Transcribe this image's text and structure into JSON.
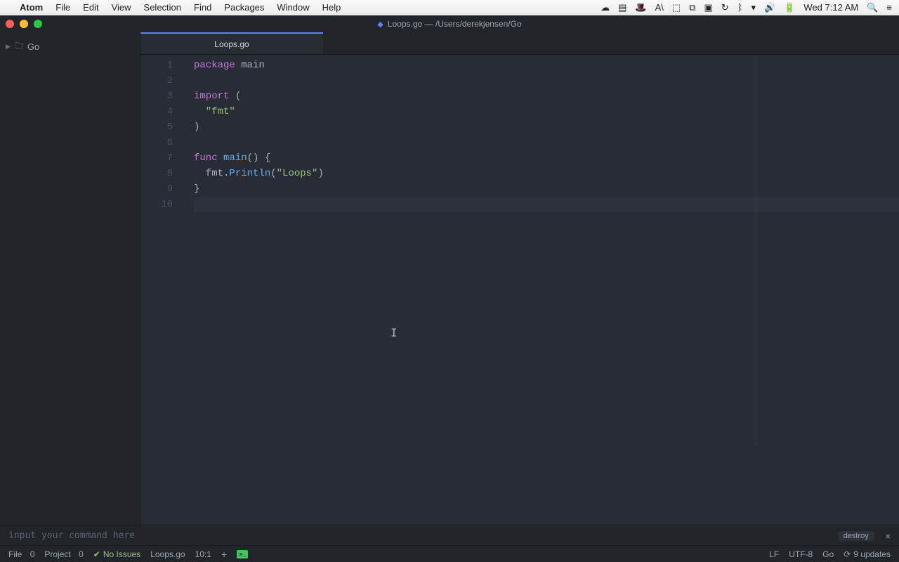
{
  "menubar": {
    "app_name": "Atom",
    "items": [
      "File",
      "Edit",
      "View",
      "Selection",
      "Find",
      "Packages",
      "Window",
      "Help"
    ],
    "clock": "Wed 7:12 AM"
  },
  "window": {
    "title_file": "Loops.go",
    "title_sep": " — ",
    "title_path": "/Users/derekjensen/Go"
  },
  "sidebar": {
    "root_folder": "Go"
  },
  "tab": {
    "label": "Loops.go"
  },
  "code": {
    "line1_kw": "package",
    "line1_ident": " main",
    "line3_kw": "import",
    "line3_rest": " (",
    "line4_str": "  \"fmt\"",
    "line5": ")",
    "line7_kw": "func",
    "line7_name": " main",
    "line7_rest1": "() {",
    "line8_pre": "  fmt.",
    "line8_fn": "Println",
    "line8_open": "(",
    "line8_str": "\"Loops\"",
    "line8_close": ")",
    "line9": "}"
  },
  "gutter": {
    "n1": "1",
    "n2": "2",
    "n3": "3",
    "n4": "4",
    "n5": "5",
    "n6": "6",
    "n7": "7",
    "n8": "8",
    "n9": "9",
    "n10": "10"
  },
  "command": {
    "placeholder": "input your command here",
    "destroy": "destroy"
  },
  "status": {
    "file_label": "File",
    "file_count": "0",
    "project_label": "Project",
    "project_count": "0",
    "issues": "No Issues",
    "filename": "Loops.go",
    "cursor": "10:1",
    "line_ending": "LF",
    "encoding": "UTF-8",
    "grammar": "Go",
    "updates": "9 updates"
  }
}
